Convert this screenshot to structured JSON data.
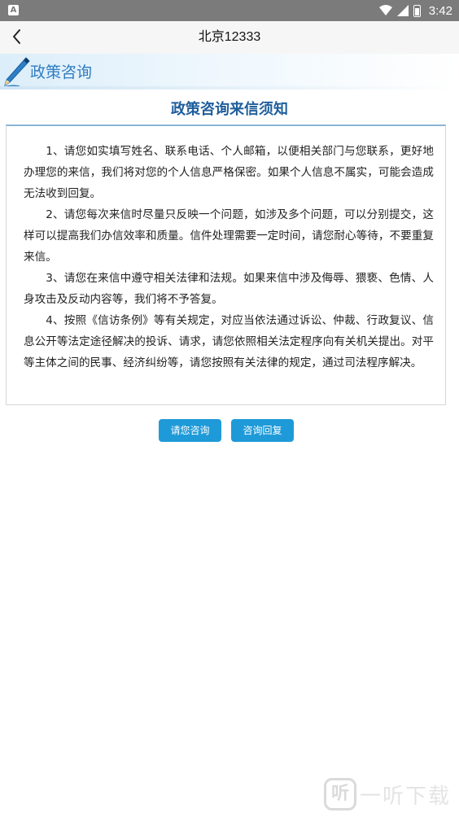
{
  "status_bar": {
    "left_icon": "A",
    "time": "3:42",
    "icons": [
      "wifi-icon",
      "signal-icon",
      "battery-icon"
    ]
  },
  "app_bar": {
    "back_icon": "chevron-left-icon",
    "title": "北京12333"
  },
  "section": {
    "icon": "pen-icon",
    "title": "政策咨询"
  },
  "notice": {
    "title": "政策咨询来信须知",
    "paragraphs": [
      "1、请您如实填写姓名、联系电话、个人邮箱，以便相关部门与您联系，更好地办理您的来信，我们将对您的个人信息严格保密。如果个人信息不属实，可能会造成无法收到回复。",
      "2、请您每次来信时尽量只反映一个问题，如涉及多个问题，可以分别提交，这样可以提高我们办信效率和质量。信件处理需要一定时间，请您耐心等待，不要重复来信。",
      "3、请您在来信中遵守相关法律和法规。如果来信中涉及侮辱、猥亵、色情、人身攻击及反动内容等，我们将不予答复。",
      "4、按照《信访条例》等有关规定，对应当依法通过诉讼、仲裁、行政复议、信息公开等法定途径解决的投诉、请求，请您依照相关法定程序向有关机关提出。对平等主体之间的民事、经济纠纷等，请您按照有关法律的规定，通过司法程序解决。"
    ]
  },
  "buttons": {
    "consult": "请您咨询",
    "reply": "咨询回复"
  },
  "watermark": {
    "logo": "听",
    "text": "一听下载"
  },
  "colors": {
    "accent": "#1f9ad8",
    "title_blue": "#1f5e9c",
    "section_blue": "#2f7cc1",
    "status_bar": "#7b7b7b"
  }
}
